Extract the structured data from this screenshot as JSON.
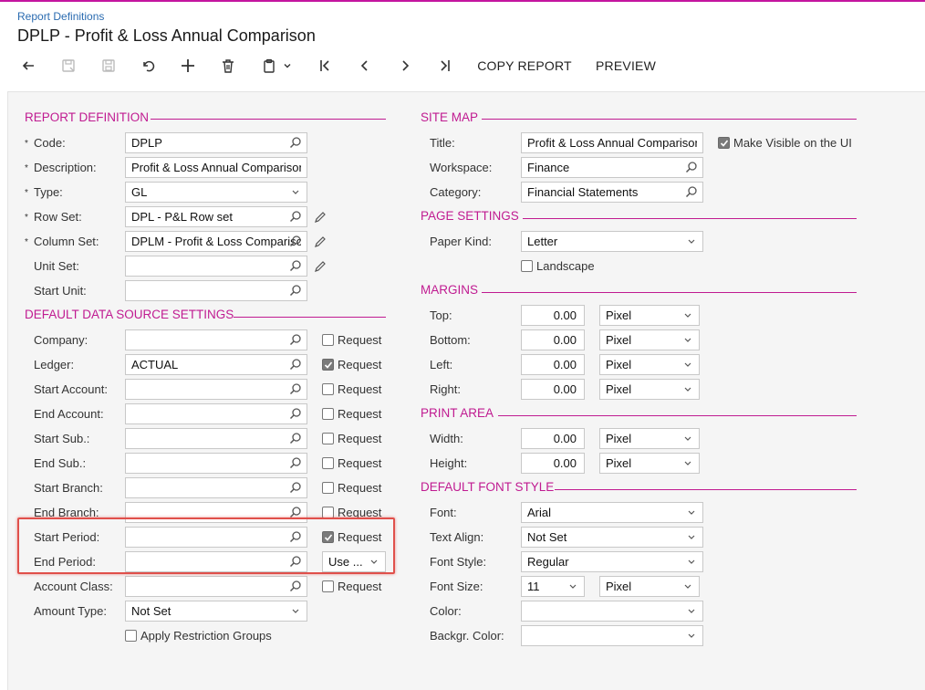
{
  "header": {
    "breadcrumb": "Report Definitions",
    "title": "DPLP - Profit & Loss Annual Comparison"
  },
  "toolbar": {
    "copy_report": "COPY REPORT",
    "preview": "PREVIEW"
  },
  "colors": {
    "accent": "#c01b91",
    "link": "#2a6bb0",
    "highlight": "#e0504b"
  },
  "report_definition": {
    "section_title": "REPORT DEFINITION",
    "code_label": "Code:",
    "code_value": "DPLP",
    "description_label": "Description:",
    "description_value": "Profit & Loss Annual Comparison",
    "type_label": "Type:",
    "type_value": "GL",
    "row_set_label": "Row Set:",
    "row_set_value": "DPL - P&L Row set",
    "column_set_label": "Column Set:",
    "column_set_value": "DPLM - Profit & Loss Comparison",
    "unit_set_label": "Unit Set:",
    "unit_set_value": "",
    "start_unit_label": "Start Unit:",
    "start_unit_value": "",
    "required_mark": "*"
  },
  "data_source": {
    "section_title": "DEFAULT DATA SOURCE SETTINGS",
    "request_label": "Request",
    "company_label": "Company:",
    "ledger_label": "Ledger:",
    "ledger_value": "ACTUAL",
    "start_account_label": "Start Account:",
    "end_account_label": "End Account:",
    "start_sub_label": "Start Sub.:",
    "end_sub_label": "End Sub.:",
    "start_branch_label": "Start Branch:",
    "end_branch_label": "End Branch:",
    "start_period_label": "Start Period:",
    "end_period_label": "End Period:",
    "end_period_option": "Use ...",
    "account_class_label": "Account Class:",
    "amount_type_label": "Amount Type:",
    "amount_type_value": "Not Set",
    "apply_restriction_label": "Apply Restriction Groups"
  },
  "site_map": {
    "section_title": "SITE MAP",
    "title_label": "Title:",
    "title_value": "Profit & Loss Annual Comparison",
    "visible_label": "Make Visible on the UI",
    "workspace_label": "Workspace:",
    "workspace_value": "Finance",
    "category_label": "Category:",
    "category_value": "Financial Statements"
  },
  "page_settings": {
    "section_title": "PAGE SETTINGS",
    "paper_kind_label": "Paper Kind:",
    "paper_kind_value": "Letter",
    "landscape_label": "Landscape"
  },
  "margins": {
    "section_title": "MARGINS",
    "top_label": "Top:",
    "top_value": "0.00",
    "bottom_label": "Bottom:",
    "bottom_value": "0.00",
    "left_label": "Left:",
    "left_value": "0.00",
    "right_label": "Right:",
    "right_value": "0.00",
    "unit_value": "Pixel"
  },
  "print_area": {
    "section_title": "PRINT AREA",
    "width_label": "Width:",
    "width_value": "0.00",
    "height_label": "Height:",
    "height_value": "0.00",
    "unit_value": "Pixel"
  },
  "font_style": {
    "section_title": "DEFAULT FONT STYLE",
    "font_label": "Font:",
    "font_value": "Arial",
    "text_align_label": "Text Align:",
    "text_align_value": "Not Set",
    "font_style_label": "Font Style:",
    "font_style_value": "Regular",
    "font_size_label": "Font Size:",
    "font_size_value": "11",
    "font_size_unit": "Pixel",
    "color_label": "Color:",
    "color_value": "",
    "backgr_color_label": "Backgr. Color:",
    "backgr_color_value": ""
  }
}
